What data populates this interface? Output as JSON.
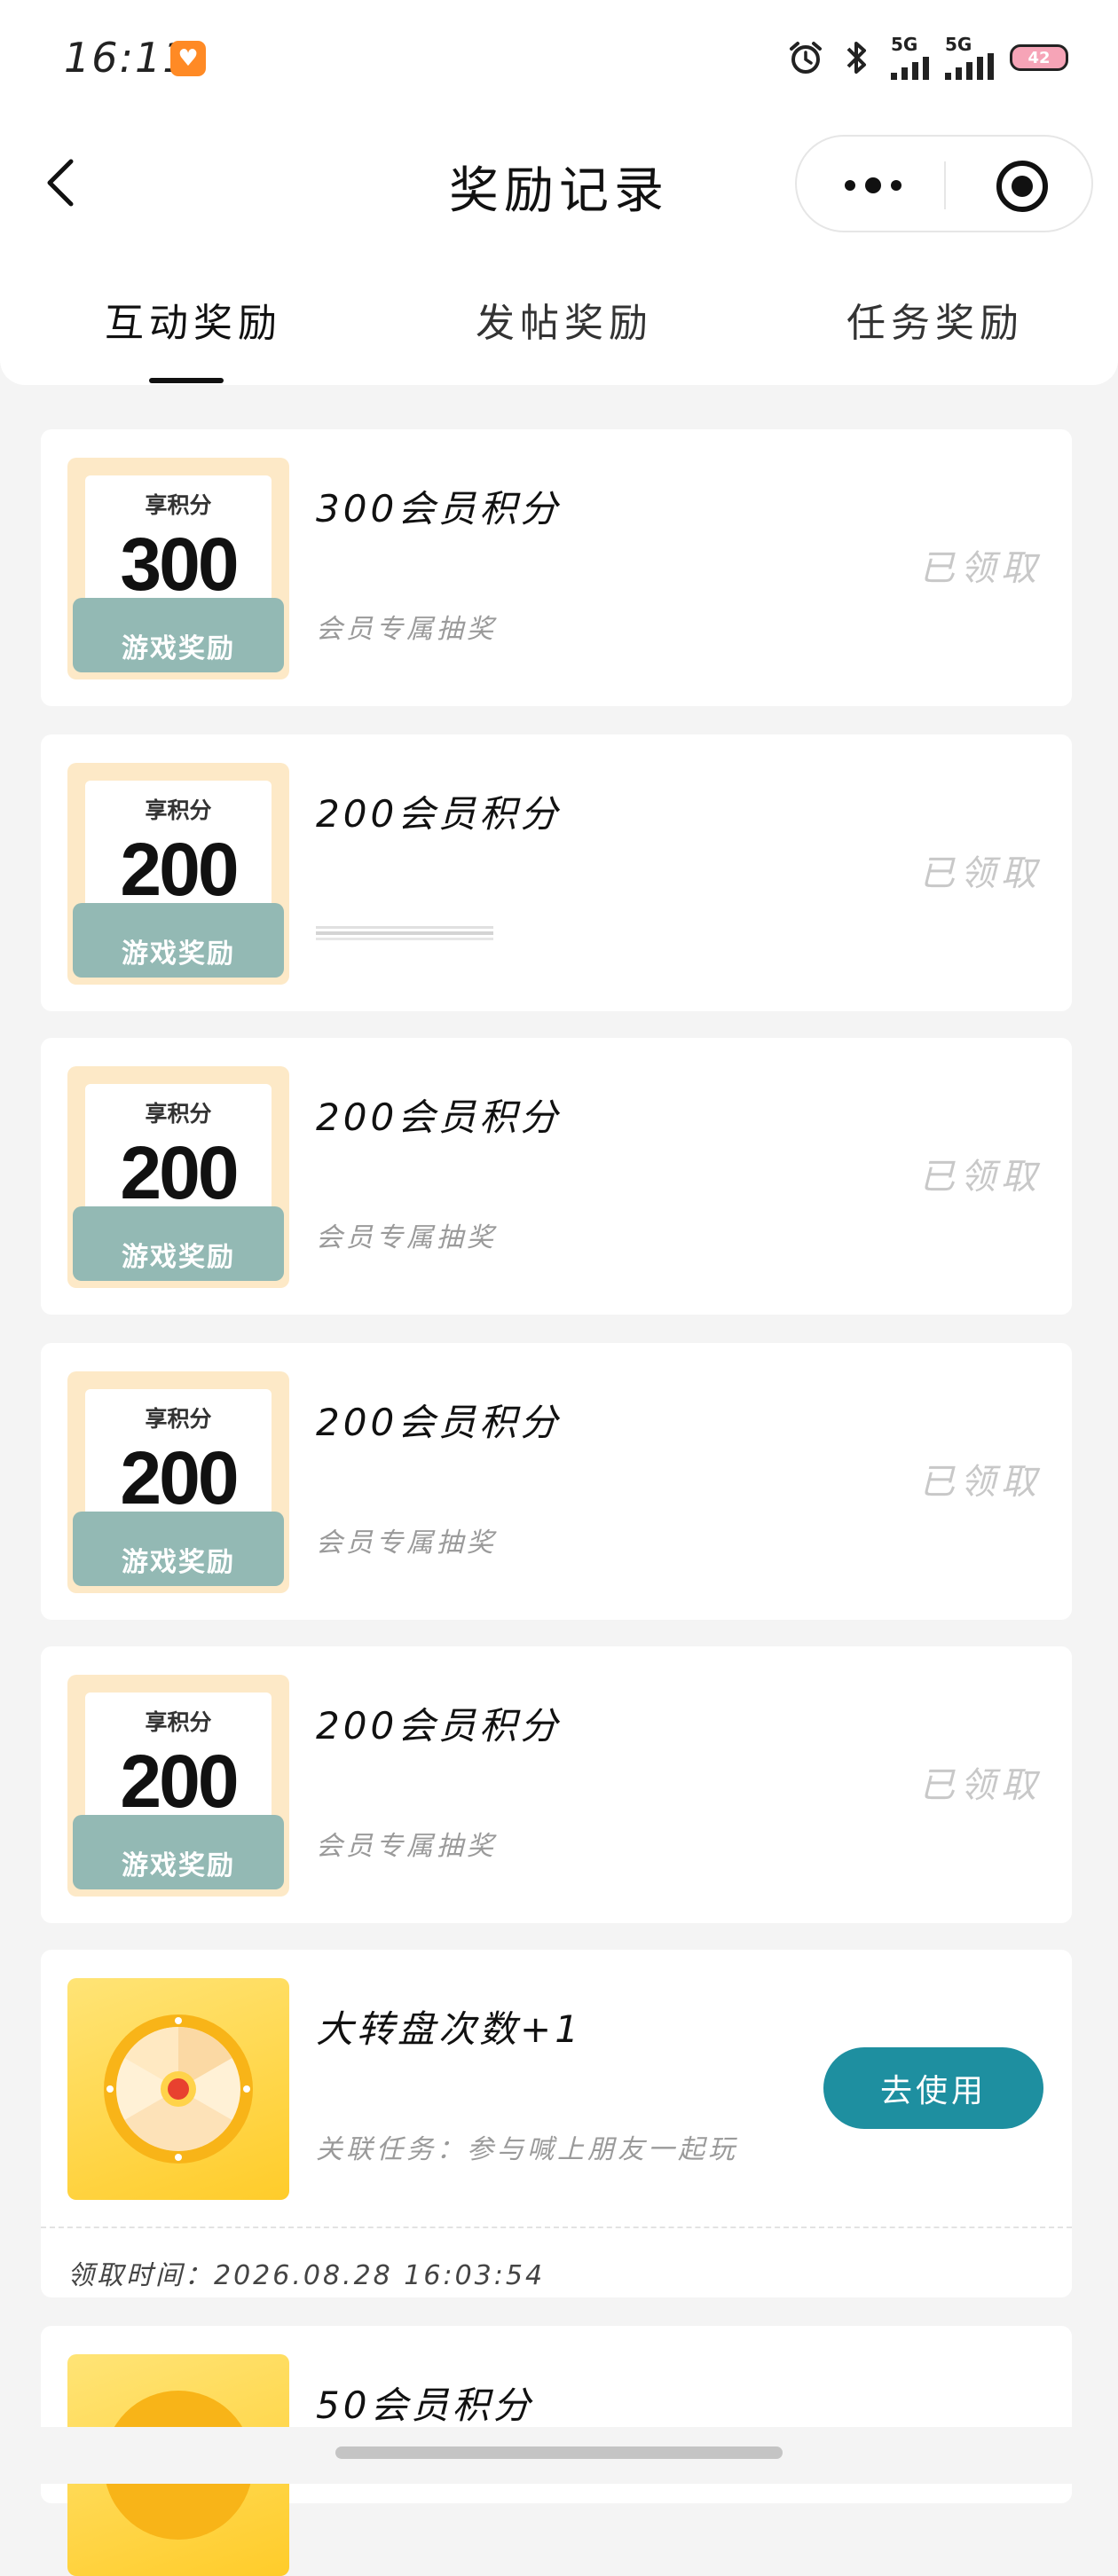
{
  "status_bar": {
    "time": "16:11",
    "app_icon": "heart-app-icon",
    "signal1": "5G",
    "signal2": "5G",
    "battery": "42"
  },
  "header": {
    "title": "奖励记录",
    "back_icon": "chevron-left-icon",
    "more_icon": "more-dots-icon",
    "target_icon": "target-icon"
  },
  "tabs": [
    {
      "label": "互动奖励",
      "active": true
    },
    {
      "label": "发帖奖励",
      "active": false
    },
    {
      "label": "任务奖励",
      "active": false
    }
  ],
  "cards": [
    {
      "thumb_label": "享积分",
      "thumb_value": "300",
      "thumb_footer": "游戏奖励",
      "title": "300会员积分",
      "subtitle": "会员专属抽奖",
      "status": "已领取"
    },
    {
      "thumb_label": "享积分",
      "thumb_value": "200",
      "thumb_footer": "游戏奖励",
      "title": "200会员积分",
      "subtitle": "",
      "status": "已领取"
    },
    {
      "thumb_label": "享积分",
      "thumb_value": "200",
      "thumb_footer": "游戏奖励",
      "title": "200会员积分",
      "subtitle": "会员专属抽奖",
      "status": "已领取"
    },
    {
      "thumb_label": "享积分",
      "thumb_value": "200",
      "thumb_footer": "游戏奖励",
      "title": "200会员积分",
      "subtitle": "会员专属抽奖",
      "status": "已领取"
    },
    {
      "thumb_label": "享积分",
      "thumb_value": "200",
      "thumb_footer": "游戏奖励",
      "title": "200会员积分",
      "subtitle": "会员专属抽奖",
      "status": "已领取"
    }
  ],
  "wheel_card": {
    "title": "大转盘次数+1",
    "subtitle": "关联任务：参与喊上朋友一起玩",
    "button": "去使用",
    "time": "领取时间：2026.08.28 16:03:54"
  },
  "partial_card": {
    "title": "50会员积分"
  },
  "colors": {
    "accent": "#1e8fa0",
    "thumb_bg": "#fde9c7",
    "thumb_band": "#93b9b4",
    "wheel_bg": "#ffd43b"
  }
}
